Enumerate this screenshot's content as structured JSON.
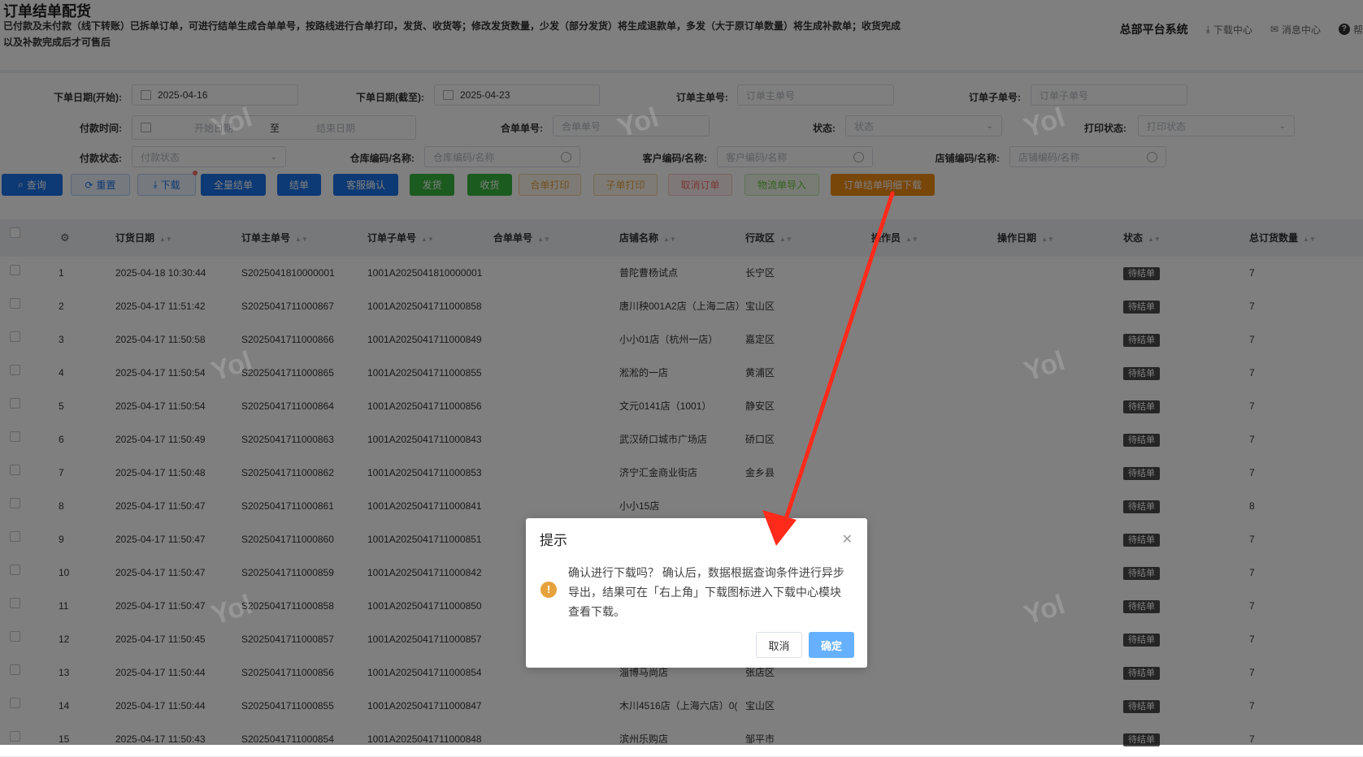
{
  "page": {
    "title": "订单结单配货",
    "description": "已付款及未付款（线下转账）已拆单订单，可进行结单生成合单单号，按路线进行合单打印，发货、收货等；修改发货数量，少发（部分发货）将生成退款单，多发（大于原订单数量）将生成补款单；收货完成以及补款完成后才可售后"
  },
  "header": {
    "system_name": "总部平台系统",
    "download_center": "下载中心",
    "message_center": "消息中心",
    "help_partial": "帮"
  },
  "filters": {
    "order_date_start_label": "下单日期(开始):",
    "order_date_start_value": "2025-04-16",
    "order_date_end_label": "下单日期(截至):",
    "order_date_end_value": "2025-04-23",
    "main_order_label": "订单主单号:",
    "main_order_placeholder": "订单主单号",
    "sub_order_label": "订单子单号:",
    "sub_order_placeholder": "订单子单号",
    "pay_time_label": "付款时间:",
    "pay_time_start_placeholder": "开始日期",
    "pay_time_sep": "至",
    "pay_time_end_placeholder": "结束日期",
    "merge_no_label": "合单单号:",
    "merge_no_placeholder": "合单单号",
    "status_label": "状态:",
    "status_placeholder": "状态",
    "print_status_label": "打印状态:",
    "print_status_placeholder": "打印状态",
    "pay_status_label": "付款状态:",
    "pay_status_placeholder": "付款状态",
    "warehouse_label": "仓库编码/名称:",
    "warehouse_placeholder": "仓库编码/名称",
    "customer_label": "客户编码/名称:",
    "customer_placeholder": "客户编码/名称",
    "store_label": "店铺编码/名称:",
    "store_placeholder": "店铺编码/名称"
  },
  "toolbar": {
    "query": "查询",
    "reset": "重置",
    "download": "下载",
    "settle_all": "全量结单",
    "settle": "结单",
    "cs_confirm": "客服确认",
    "ship": "发货",
    "receive": "收货",
    "merge_print": "合单打印",
    "sub_print": "子单打印",
    "cancel_order": "取消订单",
    "logistics_import": "物流单导入",
    "detail_download": "订单结单明细下载"
  },
  "table": {
    "headers": [
      "订货日期",
      "订单主单号",
      "订单子单号",
      "合单单号",
      "店铺名称",
      "行政区",
      "操作员",
      "操作日期",
      "状态",
      "总订货数量"
    ],
    "rows": [
      {
        "idx": "1",
        "date": "2025-04-18 10:30:44",
        "main": "S2025041810000001",
        "sub": "1001A2025041810000001",
        "merge": "",
        "store": "普陀曹杨试点",
        "district": "长宁区",
        "status": "待结单",
        "qty": "7"
      },
      {
        "idx": "2",
        "date": "2025-04-17 11:51:42",
        "main": "S2025041711000867",
        "sub": "1001A2025041711000858",
        "merge": "",
        "store": "唐川秧001A2店（上海二店）",
        "district": "宝山区",
        "status": "待结单",
        "qty": "7"
      },
      {
        "idx": "3",
        "date": "2025-04-17 11:50:58",
        "main": "S2025041711000866",
        "sub": "1001A2025041711000849",
        "merge": "",
        "store": "小小01店（杭州一店）",
        "district": "嘉定区",
        "status": "待结单",
        "qty": "7"
      },
      {
        "idx": "4",
        "date": "2025-04-17 11:50:54",
        "main": "S2025041711000865",
        "sub": "1001A2025041711000855",
        "merge": "",
        "store": "淞淞的一店",
        "district": "黄浦区",
        "status": "待结单",
        "qty": "7"
      },
      {
        "idx": "5",
        "date": "2025-04-17 11:50:54",
        "main": "S2025041711000864",
        "sub": "1001A2025041711000856",
        "merge": "",
        "store": "文元0141店（1001）",
        "district": "静安区",
        "status": "待结单",
        "qty": "7"
      },
      {
        "idx": "6",
        "date": "2025-04-17 11:50:49",
        "main": "S2025041711000863",
        "sub": "1001A2025041711000843",
        "merge": "",
        "store": "武汉硚口城市广场店",
        "district": "硚口区",
        "status": "待结单",
        "qty": "7"
      },
      {
        "idx": "7",
        "date": "2025-04-17 11:50:48",
        "main": "S2025041711000862",
        "sub": "1001A2025041711000853",
        "merge": "",
        "store": "济宁汇金商业街店",
        "district": "金乡县",
        "status": "待结单",
        "qty": "7"
      },
      {
        "idx": "8",
        "date": "2025-04-17 11:50:47",
        "main": "S2025041711000861",
        "sub": "1001A2025041711000841",
        "merge": "",
        "store": "小小15店",
        "district": "",
        "status": "待结单",
        "qty": "8"
      },
      {
        "idx": "9",
        "date": "2025-04-17 11:50:47",
        "main": "S2025041711000860",
        "sub": "1001A2025041711000851",
        "merge": "",
        "store": "",
        "district": "",
        "status": "待结单",
        "qty": "7"
      },
      {
        "idx": "10",
        "date": "2025-04-17 11:50:47",
        "main": "S2025041711000859",
        "sub": "1001A2025041711000842",
        "merge": "",
        "store": "",
        "district": "",
        "status": "待结单",
        "qty": "7"
      },
      {
        "idx": "11",
        "date": "2025-04-17 11:50:47",
        "main": "S2025041711000858",
        "sub": "1001A2025041711000850",
        "merge": "",
        "store": "",
        "district": "",
        "status": "待结单",
        "qty": "7"
      },
      {
        "idx": "12",
        "date": "2025-04-17 11:50:45",
        "main": "S2025041711000857",
        "sub": "1001A2025041711000857",
        "merge": "",
        "store": "",
        "district": "",
        "status": "待结单",
        "qty": "7"
      },
      {
        "idx": "13",
        "date": "2025-04-17 11:50:44",
        "main": "S2025041711000856",
        "sub": "1001A2025041711000854",
        "merge": "",
        "store": "淄博马尚店",
        "district": "张店区",
        "status": "待结单",
        "qty": "7"
      },
      {
        "idx": "14",
        "date": "2025-04-17 11:50:44",
        "main": "S2025041711000855",
        "sub": "1001A2025041711000847",
        "merge": "",
        "store": "木川4516店（上海六店）0(",
        "district": "宝山区",
        "status": "待结单",
        "qty": "7"
      },
      {
        "idx": "15",
        "date": "2025-04-17 11:50:43",
        "main": "S2025041711000854",
        "sub": "1001A2025041711000848",
        "merge": "",
        "store": "滨州乐购店",
        "district": "邹平市",
        "status": "待结单",
        "qty": "7"
      }
    ]
  },
  "watermark": "Yol",
  "dialog": {
    "title": "提示",
    "message": "确认进行下载吗？ 确认后，数据根据查询条件进行异步导出，结果可在「右上角」下载图标进入下载中心模块查看下载。",
    "cancel": "取消",
    "confirm": "确定"
  },
  "colors": {
    "primary": "#1a73e8",
    "success": "#38b63f",
    "warning": "#f08d12",
    "danger": "#f56c6c",
    "annotation_arrow": "#ff2a1a",
    "dialog_ok": "#66b1ff"
  }
}
